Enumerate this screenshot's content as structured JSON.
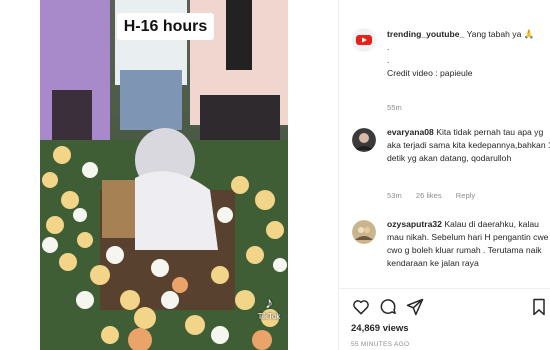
{
  "video": {
    "caption": "H-16 hours",
    "watermark": "TikTok"
  },
  "post": {
    "comments": [
      {
        "username": "trending_youtube_",
        "text": " Yang tabah ya 🙏",
        "line2": ".",
        "line3": ".",
        "line4": "Credit video : papieule",
        "time": "55m"
      },
      {
        "username": "evaryana08",
        "text": " Kita tidak pernah tau apa yg aka terjadi sama kita kedepannya,bahkan 1 detik yg akan datang, qodarulloh",
        "time": "53m",
        "likes": "26 likes",
        "reply": "Reply"
      },
      {
        "username": "ozysaputra32",
        "text": " Kalau di daerahku, kalau mau nikah. Sebelum hari H pengantin cwe cwo g boleh kluar rumah . Terutama naik kendaraan ke jalan raya"
      }
    ],
    "views": "24,869 views",
    "posted_ago": "55 MINUTES AGO"
  },
  "icons": {
    "heart": "heart-icon",
    "comment": "comment-icon",
    "share": "paper-plane-icon",
    "save": "bookmark-icon",
    "verified_avatar": "youtube-logo-icon"
  },
  "colors": {
    "text": "#262626",
    "muted": "#8e8e8e",
    "youtube_red": "#e62117"
  }
}
